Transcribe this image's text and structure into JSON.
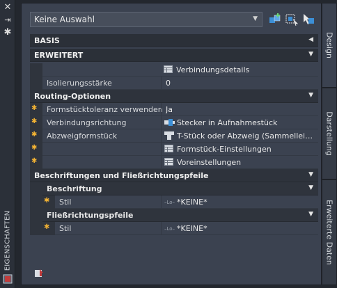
{
  "palette": {
    "title": "EIGENSCHAFTEN"
  },
  "toolbar": {
    "selection_value": "Keine Auswahl"
  },
  "sections": {
    "basis": "BASIS",
    "erweitert": "ERWEITERT",
    "routing": "Routing-Optionen",
    "beschriftungen": "Beschriftungen und Fließrichtungspfeile",
    "beschriftung": "Beschriftung",
    "fliessrichtung": "Fließrichtungspfeile"
  },
  "rows": {
    "verbindungsdetails": "Verbindungsdetails",
    "isolierung_label": "Isolierungsstärke",
    "isolierung_value": "0",
    "formstueck_label": "Formstücktoleranz verwenden",
    "formstueck_value": "Ja",
    "verbindungsrichtung_label": "Verbindungsrichtung",
    "verbindungsrichtung_value": "Stecker in Aufnahmestück",
    "abzweig_label": "Abzweigformstück",
    "abzweig_value": "T-Stück oder Abzweig (Sammellei…",
    "formstueck_einstellungen": "Formstück-Einstellungen",
    "voreinstellungen": "Voreinstellungen",
    "stil_label_1": "Stil",
    "stil_value_1": "*KEINE*",
    "stil_label_2": "Stil",
    "stil_value_2": "*KEINE*"
  },
  "tabs": [
    "Design",
    "Darstellung",
    "Erweiterte Daten"
  ],
  "colors": {
    "required_star": "#f2b233",
    "panel": "#3b4250",
    "section": "#2e333c"
  }
}
